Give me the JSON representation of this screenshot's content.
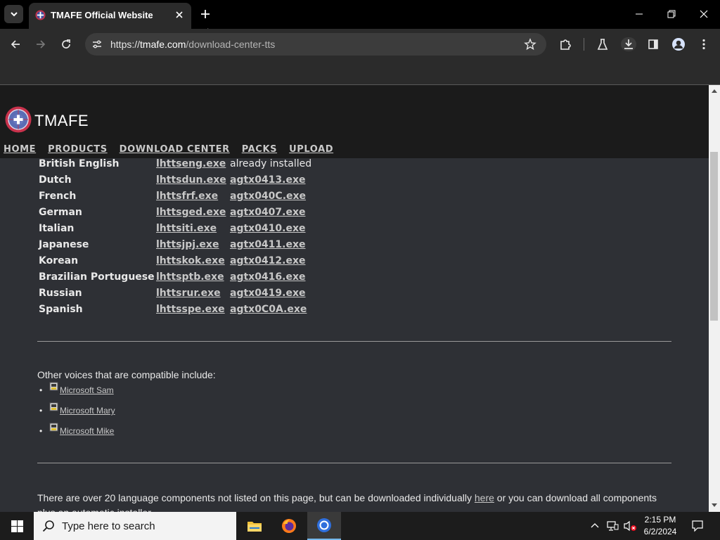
{
  "browser": {
    "tab_title": "TMAFE Official Website",
    "url_scheme": "https://",
    "url_host": "tmafe.com",
    "url_path": "/download-center-tts"
  },
  "site": {
    "logo_text": "TMAFE",
    "nav": [
      "HOME",
      "PRODUCTS",
      "DOWNLOAD CENTER",
      "PACKS",
      "UPLOAD"
    ]
  },
  "languages": [
    {
      "name": "British English",
      "file1": "lhttseng.exe",
      "file2": "already installed",
      "file2_link": false
    },
    {
      "name": "Dutch",
      "file1": "lhttsdun.exe",
      "file2": "agtx0413.exe",
      "file2_link": true
    },
    {
      "name": "French",
      "file1": "lhttsfrf.exe",
      "file2": "agtx040C.exe",
      "file2_link": true
    },
    {
      "name": "German",
      "file1": "lhttsged.exe",
      "file2": "agtx0407.exe",
      "file2_link": true
    },
    {
      "name": "Italian",
      "file1": "lhttsiti.exe",
      "file2": "agtx0410.exe",
      "file2_link": true
    },
    {
      "name": "Japanese",
      "file1": "lhttsjpj.exe",
      "file2": "agtx0411.exe",
      "file2_link": true
    },
    {
      "name": "Korean",
      "file1": "lhttskok.exe",
      "file2": "agtx0412.exe",
      "file2_link": true
    },
    {
      "name": "Brazilian Portuguese",
      "file1": "lhttsptb.exe",
      "file2": "agtx0416.exe",
      "file2_link": true
    },
    {
      "name": "Russian",
      "file1": "lhttsrur.exe",
      "file2": "agtx0419.exe",
      "file2_link": true
    },
    {
      "name": "Spanish",
      "file1": "lhttsspe.exe",
      "file2": "agtx0C0A.exe",
      "file2_link": true
    }
  ],
  "other_voices": {
    "title": "Other voices that are compatible include:",
    "items": [
      "Microsoft Sam",
      "Microsoft Mary",
      "Microsoft Mike"
    ]
  },
  "footer": {
    "text_before": "There are over 20 language components not listed on this page, but can be downloaded individually ",
    "link": "here",
    "text_after": " or you can download all components plus an automatic installer."
  },
  "taskbar": {
    "search_placeholder": "Type here to search",
    "time": "2:15 PM",
    "date": "6/2/2024"
  }
}
